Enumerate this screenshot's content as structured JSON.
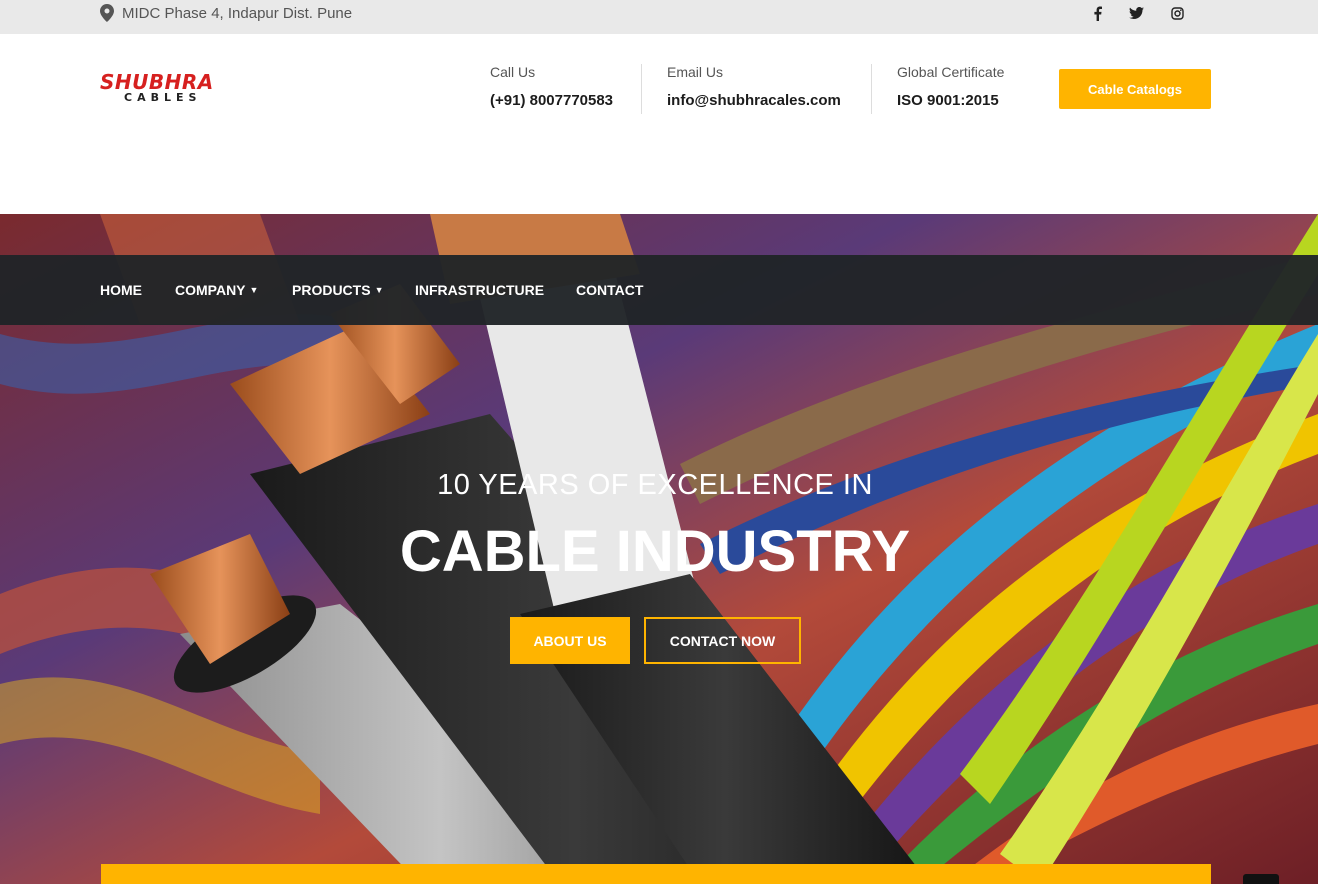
{
  "topbar": {
    "address": "MIDC Phase 4, Indapur Dist. Pune",
    "social": [
      {
        "icon": "facebook-icon",
        "glyph": "f"
      },
      {
        "icon": "twitter-icon",
        "glyph": "🐦"
      },
      {
        "icon": "instagram-icon",
        "glyph": "◎"
      }
    ]
  },
  "header": {
    "logo": {
      "line1": "SHUBHRA",
      "line2": "CABLES"
    },
    "call": {
      "label": "Call Us",
      "value": "(+91) 8007770583"
    },
    "email": {
      "label": "Email Us",
      "value": "info@shubhracales.com"
    },
    "certificate": {
      "label": "Global Certificate",
      "value": "ISO 9001:2015"
    },
    "catalog_button": "Cable Catalogs"
  },
  "nav": {
    "items": [
      {
        "label": "HOME",
        "dropdown": false
      },
      {
        "label": "COMPANY",
        "dropdown": true
      },
      {
        "label": "PRODUCTS",
        "dropdown": true
      },
      {
        "label": "INFRASTRUCTURE",
        "dropdown": false
      },
      {
        "label": "CONTACT",
        "dropdown": false
      }
    ]
  },
  "hero": {
    "subtitle": "10 YEARS OF EXCELLENCE IN",
    "title": "CABLE INDUSTRY",
    "about_button": "ABOUT US",
    "contact_button": "CONTACT NOW"
  },
  "colors": {
    "accent": "#ffb400",
    "nav_bg": "#202428",
    "logo_red": "#d6201f"
  }
}
